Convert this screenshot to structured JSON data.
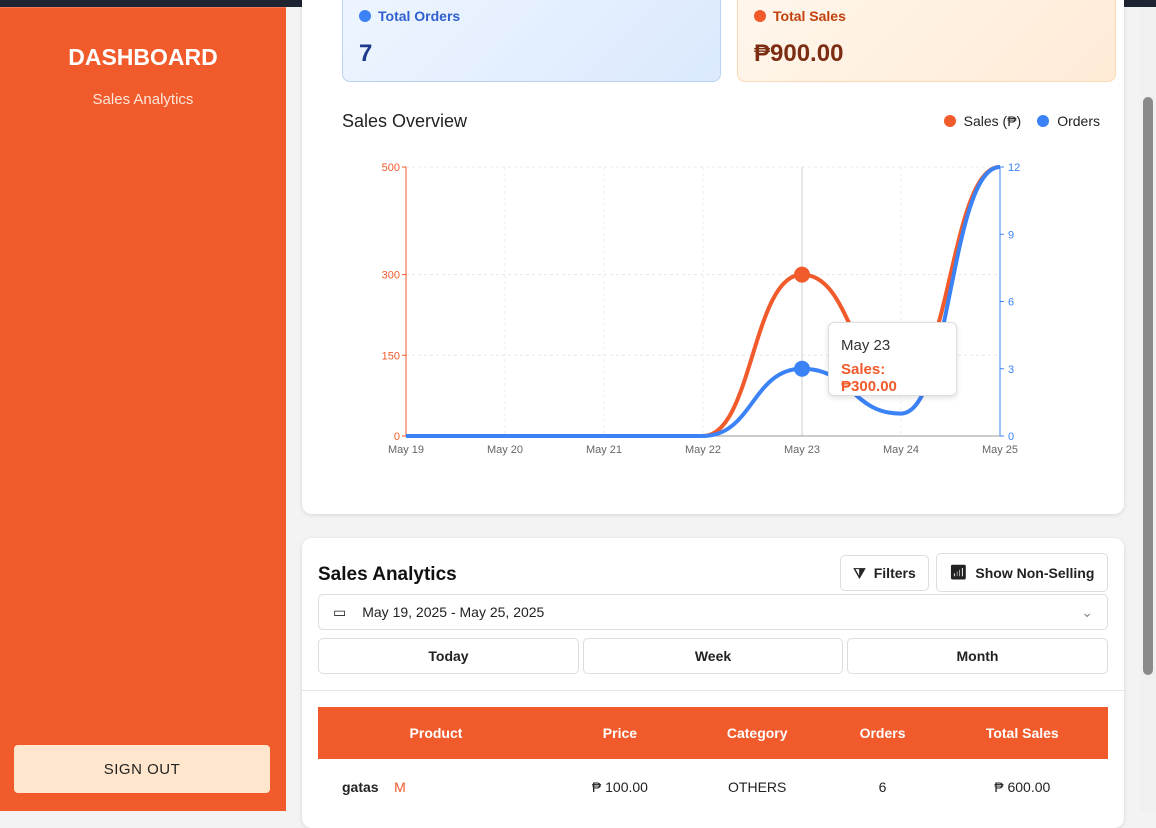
{
  "sidebar": {
    "title": "DASHBOARD",
    "subtitle": "Sales Analytics",
    "signout": "SIGN OUT"
  },
  "stats": {
    "orders_label": "Total Orders",
    "orders_value": "7",
    "sales_label": "Total Sales",
    "sales_value": "₱900.00"
  },
  "colors": {
    "brand": "#F15A2B",
    "sales": "#F15A2B",
    "orders": "#3B82F6"
  },
  "chart_data": {
    "type": "line",
    "title": "Sales Overview",
    "categories": [
      "May 19",
      "May 20",
      "May 21",
      "May 22",
      "May 23",
      "May 24",
      "May 25"
    ],
    "series": [
      {
        "name": "Sales (₱)",
        "axis": "left",
        "values": [
          0,
          0,
          0,
          0,
          300,
          100,
          500
        ]
      },
      {
        "name": "Orders",
        "axis": "right",
        "values": [
          0,
          0,
          0,
          0,
          3,
          1,
          12
        ]
      }
    ],
    "y_left": {
      "ticks": [
        0,
        150,
        300,
        500
      ],
      "range": [
        0,
        500
      ]
    },
    "y_right": {
      "ticks": [
        0,
        3,
        6,
        9,
        12
      ],
      "range": [
        0,
        12
      ]
    },
    "grid": true,
    "legend": "top-right",
    "tooltip": {
      "date": "May 23",
      "text": "Sales: ₱300.00"
    }
  },
  "analytics": {
    "title": "Sales Analytics",
    "filters": "Filters",
    "non_selling": "Show Non-Selling",
    "date_range": "May 19, 2025 - May 25, 2025",
    "periods": [
      "Today",
      "Week",
      "Month"
    ],
    "columns": [
      "Product",
      "Price",
      "Category",
      "Orders",
      "Total Sales"
    ],
    "rows": [
      {
        "product": "gatas",
        "badge": "M",
        "price": "₱ 100.00",
        "category": "OTHERS",
        "orders": "6",
        "total": "₱ 600.00"
      }
    ]
  }
}
